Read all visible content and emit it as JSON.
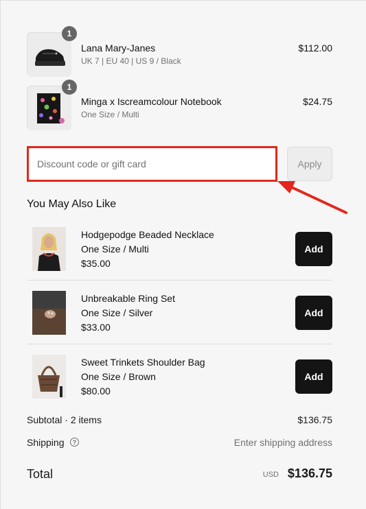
{
  "cart": {
    "items": [
      {
        "quantity": "1",
        "name": "Lana Mary-Janes",
        "variant": "UK 7 | EU 40 | US 9 / Black",
        "price": "$112.00",
        "image_icon": "black-platform-shoe-image"
      },
      {
        "quantity": "1",
        "name": "Minga x Iscreamcolour Notebook",
        "variant": "One Size / Multi",
        "price": "$24.75",
        "image_icon": "floral-notebook-image"
      }
    ]
  },
  "discount": {
    "placeholder": "Discount code or gift card",
    "value": "",
    "apply_label": "Apply",
    "highlight_color": "#e4261b"
  },
  "recommendations": {
    "heading": "You May Also Like",
    "items": [
      {
        "name": "Hodgepodge Beaded Necklace",
        "variant": "One Size / Multi",
        "price": "$35.00",
        "add_label": "Add",
        "image_icon": "model-necklace-image"
      },
      {
        "name": "Unbreakable Ring Set",
        "variant": "One Size / Silver",
        "price": "$33.00",
        "add_label": "Add",
        "image_icon": "model-rings-image"
      },
      {
        "name": "Sweet Trinkets Shoulder Bag",
        "variant": "One Size / Brown",
        "price": "$80.00",
        "add_label": "Add",
        "image_icon": "brown-bag-image"
      }
    ]
  },
  "summary": {
    "subtotal_label": "Subtotal · 2 items",
    "subtotal_value": "$136.75",
    "shipping_label": "Shipping",
    "shipping_help_icon": "question-circle-icon",
    "shipping_value": "Enter shipping address",
    "total_label": "Total",
    "total_currency": "USD",
    "total_value": "$136.75"
  },
  "colors": {
    "primary_button": "#141414",
    "annotation": "#e4261b"
  }
}
